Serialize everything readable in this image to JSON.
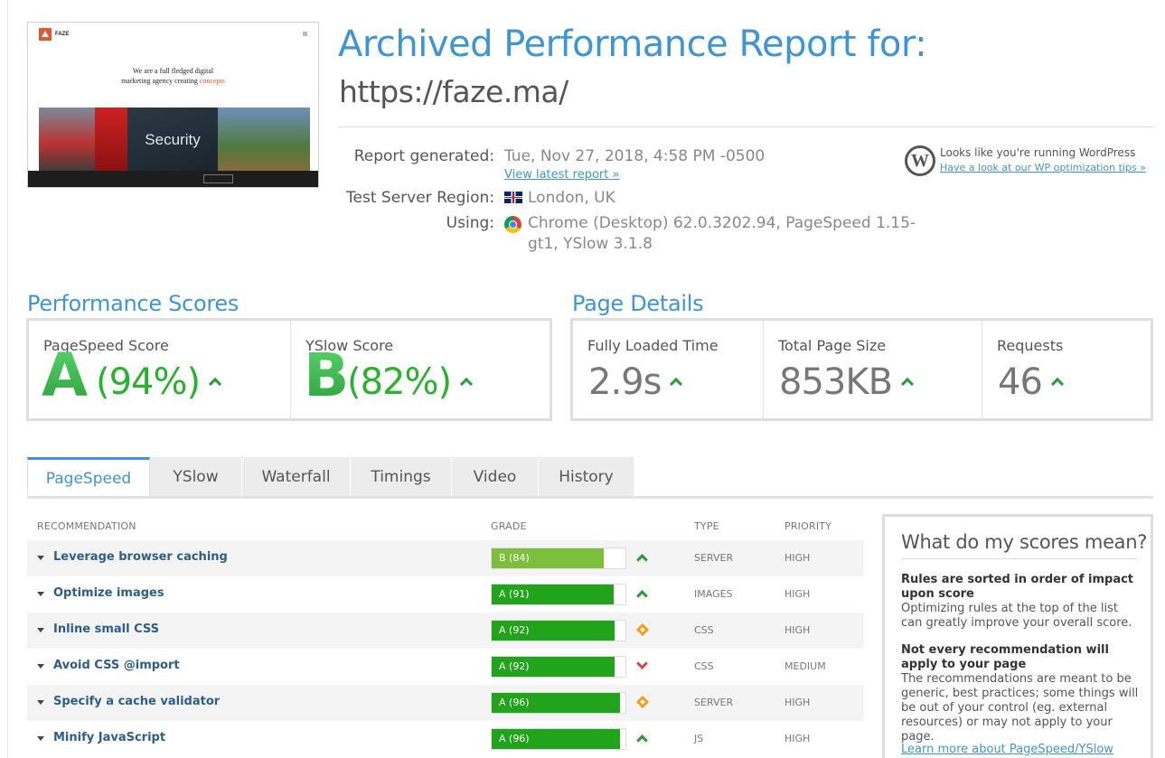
{
  "header": {
    "title": "Archived Performance Report for:",
    "url": "https://faze.ma/"
  },
  "thumbnail": {
    "logo": "FAZE",
    "tagline_1": "We are a full fledged digital",
    "tagline_2": "marketing agency creating",
    "tagline_hl": "concepts",
    "hero_word": "Security"
  },
  "meta": {
    "report_label": "Report generated:",
    "report_value": "Tue, Nov 27, 2018, 4:58 PM -0500",
    "view_latest": "View latest report »",
    "region_label": "Test Server Region:",
    "region_value": "London, UK",
    "using_label": "Using:",
    "using_line1": "Chrome (Desktop) 62.0.3202.94, PageSpeed 1.15-",
    "using_line2": "gt1, YSlow 3.1.8"
  },
  "wordpress": {
    "text": "Looks like you're running WordPress",
    "link": "Have a look at our WP optimization tips »"
  },
  "scores": {
    "heading": "Performance Scores",
    "pagespeed_label": "PageSpeed Score",
    "pagespeed_grade": "A",
    "pagespeed_pct": "(94%)",
    "yslow_label": "YSlow Score",
    "yslow_grade": "B",
    "yslow_pct": "(82%)"
  },
  "details": {
    "heading": "Page Details",
    "load_label": "Fully Loaded Time",
    "load_value": "2.9s",
    "size_label": "Total Page Size",
    "size_value": "853KB",
    "req_label": "Requests",
    "req_value": "46"
  },
  "tabs": [
    "PageSpeed",
    "YSlow",
    "Waterfall",
    "Timings",
    "Video",
    "History"
  ],
  "table": {
    "headers": {
      "recommendation": "RECOMMENDATION",
      "grade": "GRADE",
      "type": "TYPE",
      "priority": "PRIORITY"
    },
    "rows": [
      {
        "name": "Leverage browser caching",
        "grade": "B (84)",
        "score": 84,
        "trend": "up",
        "type": "SERVER",
        "priority": "HIGH"
      },
      {
        "name": "Optimize images",
        "grade": "A (91)",
        "score": 91,
        "trend": "up",
        "type": "IMAGES",
        "priority": "HIGH"
      },
      {
        "name": "Inline small CSS",
        "grade": "A (92)",
        "score": 92,
        "trend": "same",
        "type": "CSS",
        "priority": "HIGH"
      },
      {
        "name": "Avoid CSS @import",
        "grade": "A (92)",
        "score": 92,
        "trend": "down",
        "type": "CSS",
        "priority": "MEDIUM"
      },
      {
        "name": "Specify a cache validator",
        "grade": "A (96)",
        "score": 96,
        "trend": "same",
        "type": "SERVER",
        "priority": "HIGH"
      },
      {
        "name": "Minify JavaScript",
        "grade": "A (96)",
        "score": 96,
        "trend": "up",
        "type": "JS",
        "priority": "HIGH"
      }
    ]
  },
  "side": {
    "title": "What do my scores mean?",
    "b1_title": "Rules are sorted in order of impact upon score",
    "b1_text": "Optimizing rules at the top of the list can greatly improve your overall score.",
    "b2_title": "Not every recommendation will apply to your page",
    "b2_text": "The recommendations are meant to be generic, best practices; some things will be out of your control (eg. external resources) or may not apply to your page.",
    "learn_more": "Learn more about PageSpeed/YSlow"
  },
  "colors": {
    "accent": "#3f95d4",
    "grade_a": "#21a41c",
    "grade_b": "#7cbf3a",
    "trend_up": "#2a9a3a",
    "trend_down": "#d9434e",
    "trend_same": "#f0a020"
  }
}
